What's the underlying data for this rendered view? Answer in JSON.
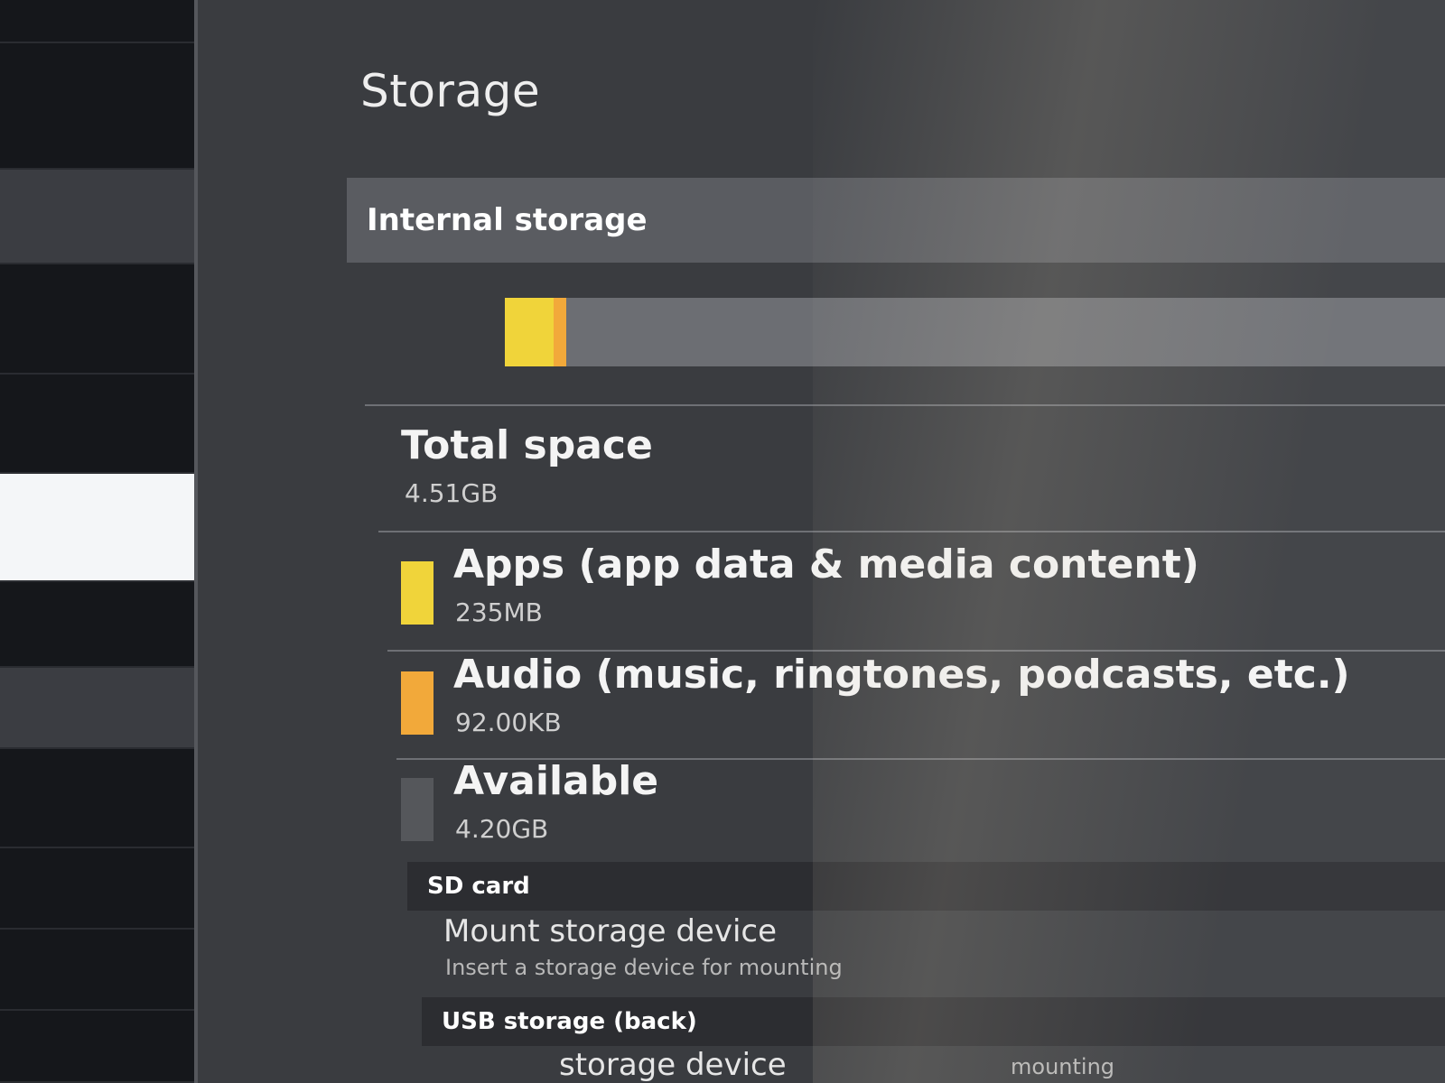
{
  "page": {
    "title": "Storage"
  },
  "internal_storage": {
    "header": "Internal storage",
    "usage": {
      "apps_fraction": 0.052,
      "audio_fraction": 0.003,
      "apps_color": "#f0d43a",
      "audio_color": "#f2a93a",
      "available_color": "#6c6e73"
    },
    "total": {
      "label": "Total space",
      "value": "4.51GB"
    },
    "items": [
      {
        "label": "Apps (app data & media content)",
        "value": "235MB",
        "color": "#f0d43a"
      },
      {
        "label": "Audio (music, ringtones, podcasts, etc.)",
        "value": "92.00KB",
        "color": "#f2a93a"
      },
      {
        "label": "Available",
        "value": "4.20GB",
        "color": "#55575b"
      }
    ]
  },
  "sd_card": {
    "header": "SD card",
    "mount_title": "Mount storage device",
    "mount_sub": "Insert a storage device for mounting"
  },
  "usb_storage": {
    "header": "USB storage (back)",
    "mount_title": "storage device",
    "mount_sub": "mounting"
  }
}
